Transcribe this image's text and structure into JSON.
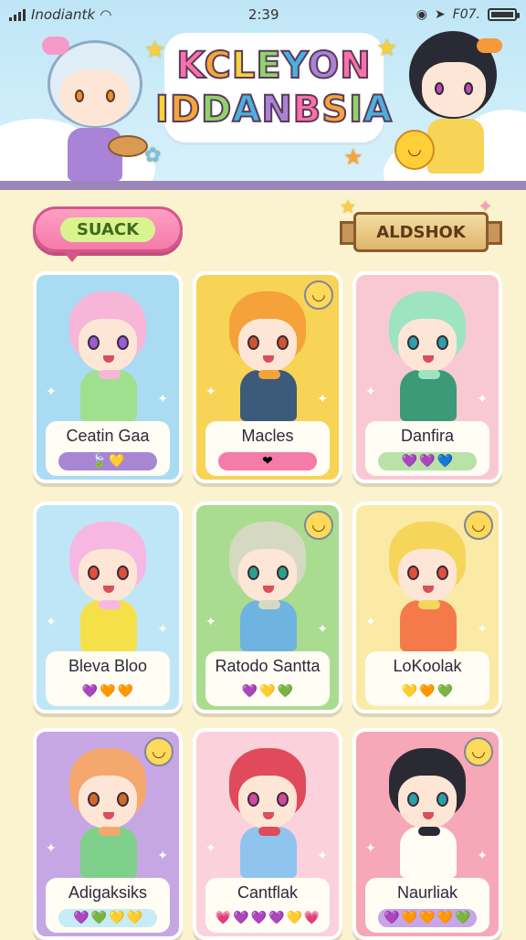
{
  "status_bar": {
    "carrier": "Inodiantk",
    "time": "2:39",
    "right_text": "F07."
  },
  "logo": {
    "line1": "KCLEYON",
    "line2": "IDDANBSIA"
  },
  "buttons": {
    "snack": "SUACK",
    "aldshok": "ALDSHOK"
  },
  "colors": {
    "header_bar": "#9b86b8",
    "page_bg": "#fbf3cf"
  },
  "cards": [
    {
      "name": "Ceatin Gaa",
      "bg": "#a9dbf3",
      "hair": "#f7b6d8",
      "eyes": "#9a5bd6",
      "outfit": "#9fe08f",
      "bar": "#a786d4",
      "hearts": [
        "💛"
      ],
      "prefix": "🍃",
      "emoji": ""
    },
    {
      "name": "Macles",
      "bg": "#f7d356",
      "hair": "#f5a23a",
      "eyes": "#d0552a",
      "outfit": "#3c5a7a",
      "bar": "#f57ba9",
      "hearts": [
        "❤"
      ],
      "prefix": "",
      "emoji": "◡"
    },
    {
      "name": "Danfira",
      "bg": "#f9c9d3",
      "hair": "#9fe4c0",
      "eyes": "#2aa0a8",
      "outfit": "#3c9a78",
      "bar": "#b9e2a8",
      "hearts": [
        "💜",
        "💜",
        "💙"
      ],
      "prefix": "",
      "emoji": ""
    },
    {
      "name": "Bleva Bloo",
      "bg": "#bfe6f6",
      "hair": "#f6b8e2",
      "eyes": "#e0503a",
      "outfit": "#f6e04a",
      "bar": "#fffdf4",
      "hearts": [
        "💜",
        "🧡",
        "🧡"
      ],
      "prefix": "",
      "emoji": ""
    },
    {
      "name": "Ratodo Santta",
      "bg": "#a9dc8e",
      "hair": "#d6d9c2",
      "eyes": "#2aa08a",
      "outfit": "#6fb3e0",
      "bar": "#fffdf4",
      "hearts": [
        "💜",
        "💛",
        "💚"
      ],
      "prefix": "",
      "emoji": "◡"
    },
    {
      "name": "LoKoolak",
      "bg": "#fbe9a6",
      "hair": "#f6d65a",
      "eyes": "#e0503a",
      "outfit": "#f57a4a",
      "bar": "#fffdf4",
      "hearts": [
        "💛",
        "🧡",
        "💚"
      ],
      "prefix": "",
      "emoji": "◡"
    },
    {
      "name": "Adigaksiks",
      "bg": "#c7a6e4",
      "hair": "#f5a86e",
      "eyes": "#d06a2a",
      "outfit": "#7fd08a",
      "bar": "#c6ecf5",
      "hearts": [
        "💜",
        "💚",
        "💛",
        "💛"
      ],
      "prefix": "",
      "emoji": "◡"
    },
    {
      "name": "Cantflak",
      "bg": "#fbd2dc",
      "hair": "#e04a5a",
      "eyes": "#d04aa0",
      "outfit": "#8fc4ef",
      "bar": "#fffdf4",
      "hearts": [
        "💗",
        "💜",
        "💜",
        "💜",
        "💛",
        "💗"
      ],
      "prefix": "",
      "emoji": ""
    },
    {
      "name": "Naurliak",
      "bg": "#f6a8b8",
      "hair": "#2a2a34",
      "eyes": "#2aa0a8",
      "outfit": "#fffdf4",
      "bar": "#c6a6e8",
      "hearts": [
        "💜",
        "🧡",
        "🧡",
        "🧡",
        "💚"
      ],
      "prefix": "",
      "emoji": "◡"
    }
  ]
}
